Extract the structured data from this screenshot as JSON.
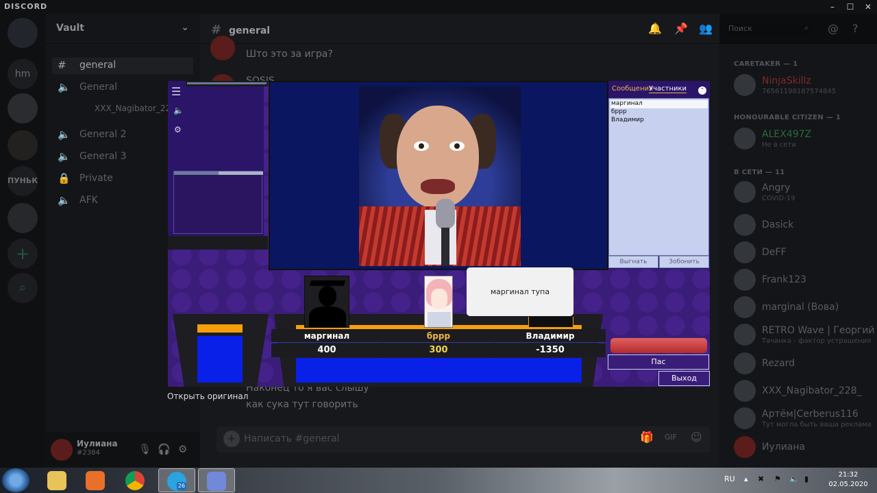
{
  "titlebar": {
    "brand": "DISCORD",
    "minimize_glyph": "–",
    "maximize_glyph": "☐",
    "close_glyph": "✕"
  },
  "servers": [
    {
      "label": ""
    },
    {
      "label": "hm"
    },
    {
      "label": ""
    },
    {
      "label": ""
    },
    {
      "label": "ПУНЬК"
    },
    {
      "label": ""
    },
    {
      "label": "+"
    },
    {
      "label": "⌕"
    }
  ],
  "guild": {
    "name": "Vault",
    "chevron": "⌄"
  },
  "channels": [
    {
      "icon": "#",
      "label": "general"
    },
    {
      "icon": "🔈",
      "label": "General"
    },
    {
      "icon": "",
      "label": "XXX_Nagibator_22"
    },
    {
      "icon": "🔈",
      "label": "General 2"
    },
    {
      "icon": "🔈",
      "label": "General 3"
    },
    {
      "icon": "🔒",
      "label": "Private"
    },
    {
      "icon": "🔈",
      "label": "AFK"
    }
  ],
  "user": {
    "name": "Иулиана",
    "tag": "#2384"
  },
  "chat": {
    "channel": "general",
    "search_placeholder": "Поиск",
    "messages": [
      {
        "text": "Што это за игра?"
      },
      {
        "text": "SOSIS"
      },
      {
        "text": "Наконец то я вас слышу"
      },
      {
        "text": "как сука тут говорить"
      }
    ],
    "input_placeholder": "Написать #general"
  },
  "members": {
    "groups": [
      {
        "header": "CARETAKER — 1"
      },
      {
        "header": "HONOURABLE CITIZEN — 1"
      },
      {
        "header": "В СЕТИ — 11"
      }
    ],
    "list": [
      {
        "name": "NinjaSkillz",
        "sub": "76561198187574845",
        "color": "#7a2a2a"
      },
      {
        "name": "ALEX497Z",
        "sub": "Не в сети",
        "color": "#2a6a3a"
      },
      {
        "name": "Angry",
        "sub": "COVID-19",
        "color": "#595b60"
      },
      {
        "name": "Dasick",
        "sub": "",
        "color": "#595b60"
      },
      {
        "name": "DeFF",
        "sub": "",
        "color": "#595b60"
      },
      {
        "name": "Frank123",
        "sub": "",
        "color": "#595b60"
      },
      {
        "name": "marginal (Вова)",
        "sub": "",
        "color": "#595b60"
      },
      {
        "name": "RETRO Wave | Георгий",
        "sub": "Тачанка - фактор устрашения",
        "color": "#595b60"
      },
      {
        "name": "Rezard",
        "sub": "",
        "color": "#595b60"
      },
      {
        "name": "XXX_Nagibator_228_",
        "sub": "",
        "color": "#595b60"
      },
      {
        "name": "Артём|Cerberus116",
        "sub": "Тут могла быть ваша реклама",
        "color": "#595b60"
      },
      {
        "name": "Иулиана",
        "sub": "",
        "color": "#595b60"
      }
    ]
  },
  "game": {
    "menu_icon": "☰",
    "sound_icon": "🔈",
    "settings_icon": "⚙",
    "progress": 0.5,
    "panel": {
      "tab_messages": "Сообщения",
      "tab_participants": "Участники",
      "collapse_glyph": "⌃",
      "participants": [
        "маргинал",
        "бррр",
        "Владимир"
      ],
      "kick_label": "Выгнать",
      "call_label": "Зобонить"
    },
    "bubble_text": "маргинал тупа",
    "players": [
      {
        "name": "маргинал",
        "score": "400"
      },
      {
        "name": "бррр",
        "score": "300"
      },
      {
        "name": "Владимир",
        "score": "-1350"
      }
    ],
    "pass_label": "Пас",
    "exit_label": "Выход"
  },
  "open_original": "Открыть оригинал",
  "taskbar": {
    "lang": "RU",
    "time": "21:32",
    "date": "02.05.2020",
    "telegram_badge": "26"
  },
  "colors": {
    "accent_orange": "#f59f0b",
    "game_purple": "#3a1d78",
    "podium_blue": "#0820e8"
  }
}
